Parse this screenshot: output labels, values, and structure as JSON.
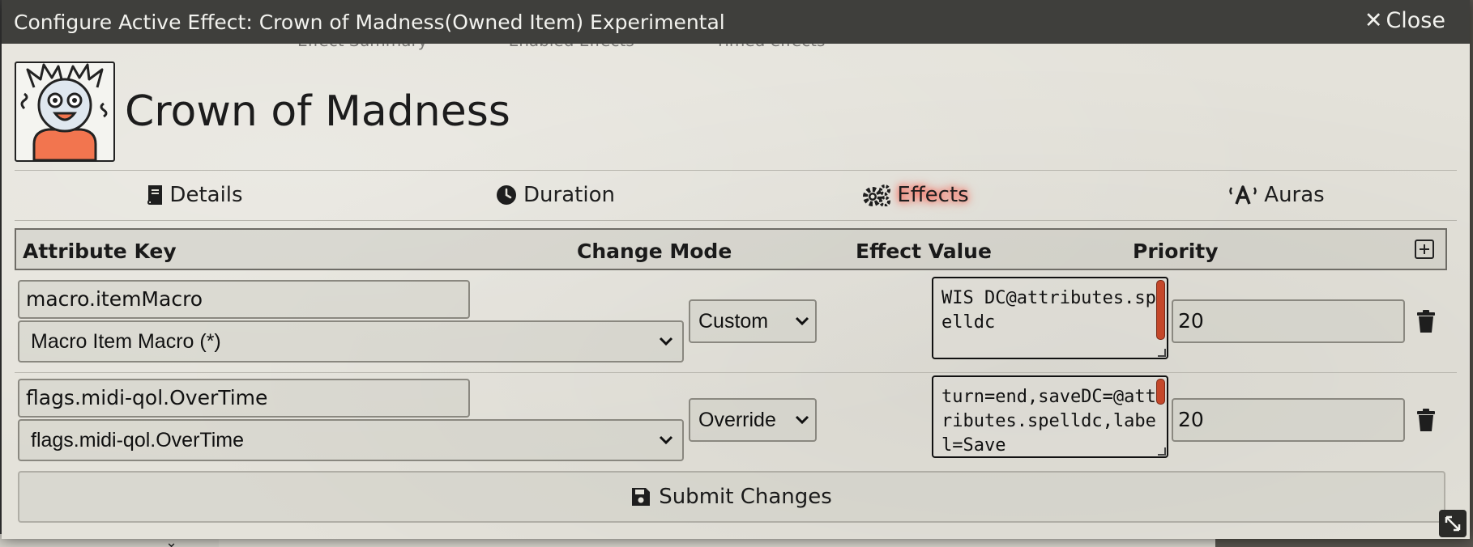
{
  "window": {
    "title": "Configure Active Effect: Crown of Madness(Owned Item) Experimental",
    "close_label": "Close"
  },
  "background": {
    "tabs": [
      "Effect Summary",
      "Enabled Effects",
      "Timed effects"
    ]
  },
  "header": {
    "effect_name": "Crown of Madness",
    "avatar_icon": "crazy-face-icon"
  },
  "tabs": [
    {
      "label": "Details",
      "icon": "book-icon",
      "active": false
    },
    {
      "label": "Duration",
      "icon": "clock-icon",
      "active": false
    },
    {
      "label": "Effects",
      "icon": "gears-icon",
      "active": true
    },
    {
      "label": "Auras",
      "icon": "broadcast-icon",
      "active": false
    }
  ],
  "table": {
    "headers": {
      "attribute_key": "Attribute Key",
      "change_mode": "Change Mode",
      "effect_value": "Effect Value",
      "priority": "Priority"
    },
    "rows": [
      {
        "key": "macro.itemMacro",
        "key_option": "Macro Item Macro (*)",
        "mode": "Custom",
        "value": "WIS DC@attributes.spelldc",
        "priority": "20"
      },
      {
        "key": "flags.midi-qol.OverTime",
        "key_option": "flags.midi-qol.OverTime",
        "mode": "Override",
        "value": "turn=end,saveDC=@attributes.spelldc,label=Save",
        "priority": "20"
      }
    ]
  },
  "submit_label": "Submit Changes",
  "colors": {
    "titlebar": "#3f3f3c",
    "active_tab_glow": "#ff4b3a",
    "scroll_thumb": "#c4472a"
  }
}
